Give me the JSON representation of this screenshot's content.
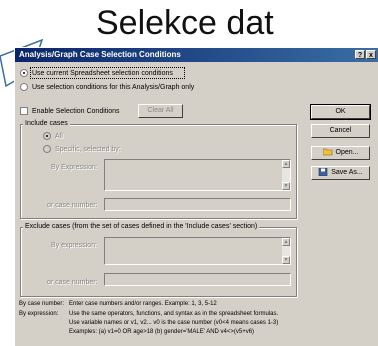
{
  "slide": {
    "title": "Selekce dat"
  },
  "dialog": {
    "title": "Analysis/Graph Case Selection Conditions",
    "help_btn": "?",
    "close_btn": "x",
    "radio_current": "Use current Spreadsheet selection conditions",
    "radio_analysis": "Use selection conditions for this Analysis/Graph only",
    "enable_label": "Enable Selection Conditions",
    "clear_all": "Clear All",
    "include": {
      "legend": "Include cases",
      "all": "All",
      "specific": "Specific, selected by:",
      "by_expression": "By Expression:",
      "case_number": "or case number:"
    },
    "exclude": {
      "legend": "Exclude cases (from the set of cases defined in the 'Include cases' section)",
      "by_expression": "By expression:",
      "case_number": "or case number:"
    },
    "buttons": {
      "ok": "OK",
      "cancel": "Cancel",
      "open": "Open...",
      "save_as": "Save As..."
    },
    "footer": {
      "case_number_key": "By case number:",
      "case_number_text": "Enter case numbers and/or ranges.  Example:  1, 3, 5-12",
      "expression_key": "By expression:",
      "expression_line1": "Use the same operators, functions, and syntax as in the spreadsheet formulas.",
      "expression_line2": "Use variable names or v1, v2...   v0 is the case number  (v0<4 means cases 1-3)",
      "expression_line3": "Examples:  (a) v1=0 OR age>18  (b) gender='MALE' AND v4<>(v5+v6)"
    }
  },
  "colors": {
    "titlebar_start": "#0a246a",
    "titlebar_end": "#3a6ea5",
    "face": "#d4d0c8"
  }
}
